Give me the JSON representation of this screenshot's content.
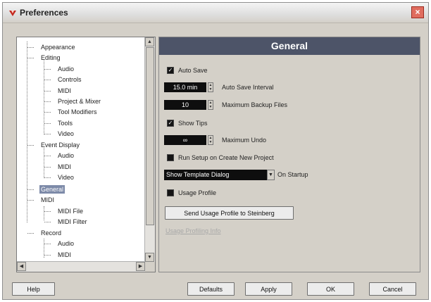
{
  "window": {
    "title": "Preferences",
    "close_glyph": "×"
  },
  "tree": {
    "items": [
      {
        "label": "Appearance"
      },
      {
        "label": "Editing"
      },
      {
        "label": "Audio"
      },
      {
        "label": "Controls"
      },
      {
        "label": "MIDI"
      },
      {
        "label": "Project & Mixer"
      },
      {
        "label": "Tool Modifiers"
      },
      {
        "label": "Tools"
      },
      {
        "label": "Video"
      },
      {
        "label": "Event Display"
      },
      {
        "label": "Audio"
      },
      {
        "label": "MIDI"
      },
      {
        "label": "Video"
      },
      {
        "label": "General",
        "selected": true
      },
      {
        "label": "MIDI"
      },
      {
        "label": "MIDI File"
      },
      {
        "label": "MIDI Filter"
      },
      {
        "label": "Record"
      },
      {
        "label": "Audio"
      },
      {
        "label": "MIDI"
      }
    ]
  },
  "panel": {
    "title": "General",
    "auto_save": {
      "label": "Auto Save",
      "checked": true
    },
    "auto_save_interval": {
      "value": "15.0 min",
      "label": "Auto Save Interval"
    },
    "max_backup": {
      "value": "10",
      "label": "Maximum Backup Files"
    },
    "show_tips": {
      "label": "Show Tips",
      "checked": true
    },
    "max_undo": {
      "value": "∞",
      "label": "Maximum Undo"
    },
    "run_setup": {
      "label": "Run Setup on Create New Project",
      "checked": false
    },
    "startup": {
      "value": "Show Template Dialog",
      "label": "On Startup"
    },
    "usage_profile": {
      "label": "Usage Profile",
      "checked": false
    },
    "send_button": "Send Usage Profile to Steinberg",
    "info_link": "Usage Profiling Info"
  },
  "buttons": {
    "help": "Help",
    "defaults": "Defaults",
    "apply": "Apply",
    "ok": "OK",
    "cancel": "Cancel"
  },
  "colors": {
    "header_bg": "#4d5468",
    "selected_bg": "#7d8aa8",
    "field_bg": "#0e0e0e",
    "close_bg": "#e06d5f"
  }
}
